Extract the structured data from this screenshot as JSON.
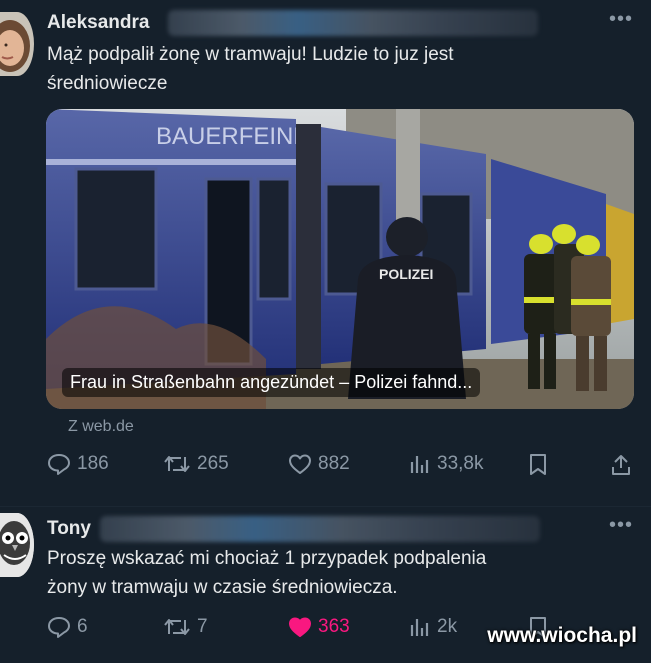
{
  "tweet1": {
    "author": "Aleksandra",
    "text_line1": "Mąż podpalił żonę w tramwaju! Ludzie to juz jest",
    "text_line2": "średniowiecze",
    "media": {
      "caption": "Frau in Straßenbahn angezündet – Polizei fahnd...",
      "tram_lettering": "BAUERFEIND",
      "vest_label": "POLIZEI"
    },
    "source": "Z web.de",
    "stats": {
      "replies": "186",
      "reposts": "265",
      "likes": "882",
      "views": "33,8k"
    }
  },
  "tweet2": {
    "author": "Tony",
    "text_line1": "Proszę wskazać mi chociaż 1 przypadek podpalenia",
    "text_line2": "żony w tramwaju w czasie średniowiecza.",
    "stats": {
      "replies": "6",
      "reposts": "7",
      "likes": "363",
      "views": "2k"
    }
  },
  "more_glyph": "•••",
  "watermark": "www.wiocha.pl",
  "colors": {
    "background": "#15202b",
    "text": "#e7e9ea",
    "muted": "#8b98a5",
    "liked": "#f91880"
  },
  "icons": [
    "reply-icon",
    "repost-icon",
    "like-icon",
    "views-icon",
    "bookmark-icon",
    "share-icon",
    "more-icon"
  ]
}
